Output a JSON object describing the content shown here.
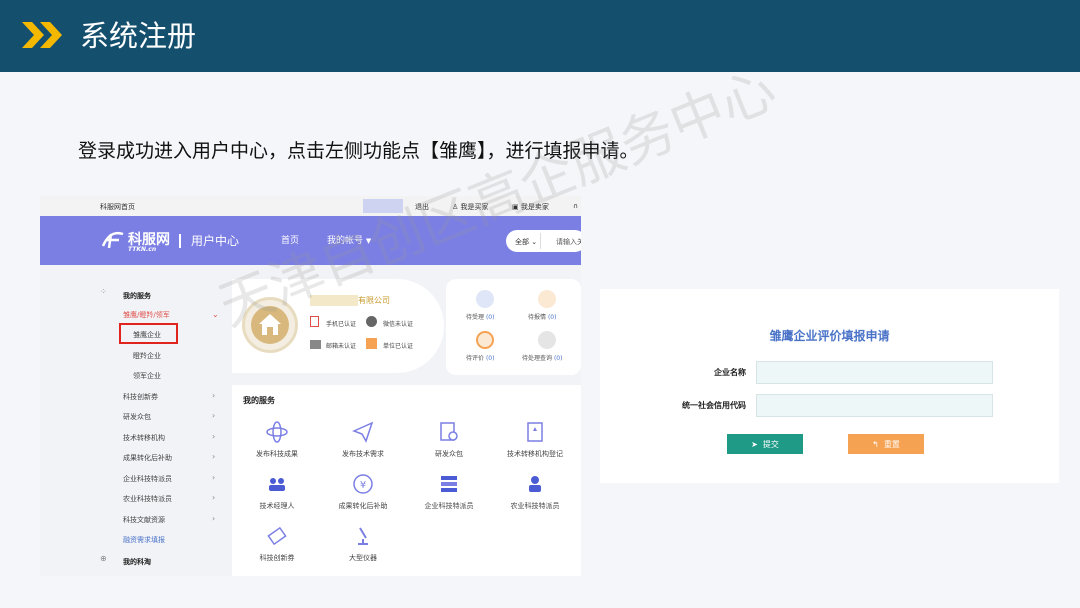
{
  "slide": {
    "title": "系统注册",
    "instruction": "登录成功进入用户中心，点击左侧功能点【雏鹰】，进行填报申请。",
    "watermark": "天津自创区高企服务中心",
    "header_color": "#154f6e",
    "chevron_color": "#f5b800"
  },
  "topbar": {
    "home": "科服网首页",
    "logout": "退出",
    "buyer": "我是买家",
    "seller": "我是卖家"
  },
  "navbar": {
    "logo": "科服网",
    "logo_sub": "TTKN.cn",
    "user_center": "用户中心",
    "home": "首页",
    "account": "我的帐号",
    "search_scope": "全部",
    "search_placeholder": "请输入关"
  },
  "sidebar": {
    "section_title": "我的服务",
    "group": "雏鹰/瞪羚/领军",
    "sub_items": [
      "雏鹰企业",
      "瞪羚企业",
      "领军企业"
    ],
    "items": [
      "科技创新券",
      "研发众包",
      "技术转移机构",
      "成果转化后补助",
      "企业科技特派员",
      "农业科技特派员",
      "科技文献资源",
      "融资需求填报"
    ],
    "bottom": "我的科淘"
  },
  "profile": {
    "company": "有限公司",
    "badges": [
      "手机已认证",
      "微信未认证",
      "邮箱未认证",
      "单位已认证"
    ]
  },
  "status": {
    "items": [
      {
        "label": "待受理",
        "count": "(0)"
      },
      {
        "label": "待报情",
        "count": "(0)"
      },
      {
        "label": "待评价",
        "count": "(0)"
      },
      {
        "label": "待处理查询",
        "count": "(0)"
      }
    ]
  },
  "services": {
    "title": "我的服务",
    "items": [
      "发布科技成果",
      "发布技术需求",
      "研发众包",
      "技术转移机构登记",
      "技术经理人",
      "成果转化后补助",
      "企业科技特派员",
      "农业科技特派员",
      "科技创新券",
      "大型仪器"
    ]
  },
  "form": {
    "title": "雏鹰企业评价填报申请",
    "company_label": "企业名称",
    "company_value": "",
    "credit_label": "统一社会信用代码",
    "credit_value": "",
    "submit": "提交",
    "reset": "重置",
    "submit_color": "#1f9a87",
    "reset_color": "#f5a253"
  }
}
